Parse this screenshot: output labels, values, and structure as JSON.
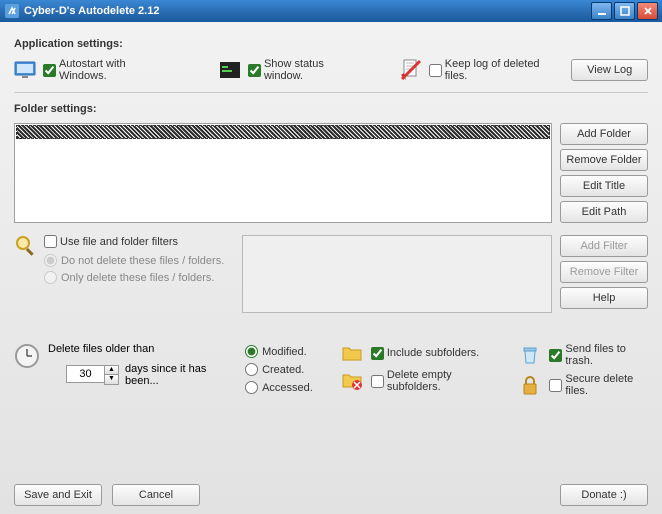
{
  "window": {
    "title": "Cyber-D's Autodelete 2.12"
  },
  "appSettings": {
    "heading": "Application settings:",
    "autostart": {
      "label": "Autostart with Windows.",
      "checked": true
    },
    "statusWindow": {
      "label": "Show status window.",
      "checked": true
    },
    "keepLog": {
      "label": "Keep log of deleted files.",
      "checked": false
    },
    "viewLog": "View Log"
  },
  "folderSettings": {
    "heading": "Folder settings:",
    "buttons": {
      "add": "Add Folder",
      "remove": "Remove Folder",
      "editTitle": "Edit Title",
      "editPath": "Edit Path"
    }
  },
  "filters": {
    "useFilters": {
      "label": "Use file and folder filters",
      "checked": false
    },
    "mode": {
      "doNotDelete": "Do not delete these files / folders.",
      "onlyDelete": "Only delete these files / folders.",
      "selected": "doNotDelete"
    },
    "buttons": {
      "add": "Add Filter",
      "remove": "Remove Filter",
      "help": "Help"
    }
  },
  "age": {
    "label": "Delete files older than",
    "days": "30",
    "suffix": "days since it has been...",
    "basis": {
      "modified": "Modified.",
      "created": "Created.",
      "accessed": "Accessed.",
      "selected": "modified"
    }
  },
  "options": {
    "includeSub": {
      "label": "Include subfolders.",
      "checked": true
    },
    "deleteEmpty": {
      "label": "Delete empty subfolders.",
      "checked": false
    },
    "trash": {
      "label": "Send files to trash.",
      "checked": true
    },
    "secure": {
      "label": "Secure delete files.",
      "checked": false
    }
  },
  "footer": {
    "save": "Save and Exit",
    "cancel": "Cancel",
    "donate": "Donate :)"
  }
}
